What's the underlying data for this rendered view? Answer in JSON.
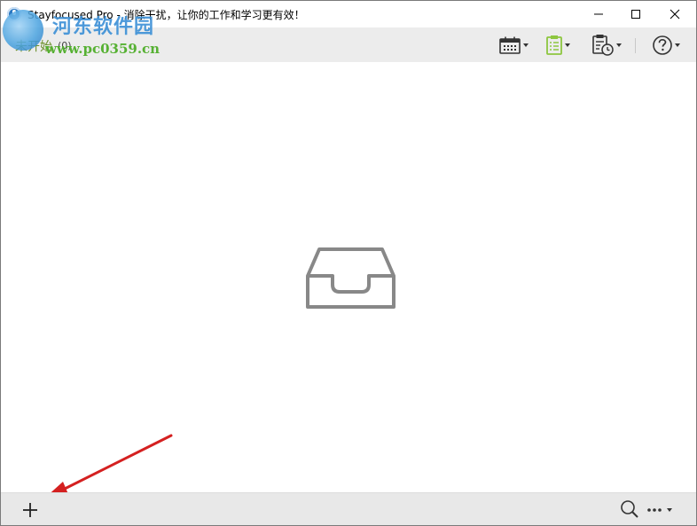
{
  "window": {
    "title": "Stayfocused Pro - 消除干扰，让你的工作和学习更有效！"
  },
  "toolbar": {
    "list_label": "未开始",
    "list_count": "(0)"
  },
  "watermark": {
    "title": "河东软件园",
    "url": "www.pc0359.cn"
  },
  "colors": {
    "list_label": "#6a8f2a",
    "clipboard_icon": "#8dc63f",
    "empty_icon": "#888888",
    "arrow": "#d42020"
  },
  "icons": {
    "minimize": "minimize-icon",
    "maximize": "maximize-icon",
    "close": "close-icon",
    "calendar": "calendar-icon",
    "clipboard": "clipboard-list-icon",
    "history": "clipboard-clock-icon",
    "help": "question-circle-icon",
    "empty": "empty-inbox-icon",
    "add": "plus-icon",
    "search": "search-icon",
    "more": "ellipsis-icon"
  }
}
